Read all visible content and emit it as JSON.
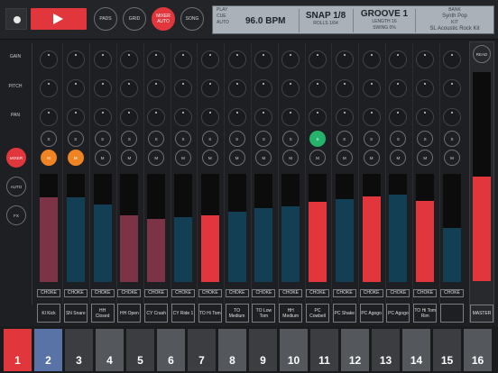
{
  "transport": {
    "record_label": "",
    "play_label": ""
  },
  "mode_buttons": [
    {
      "label": "PADS"
    },
    {
      "label": "GRID"
    },
    {
      "label": "MIXER AUTO"
    },
    {
      "label": "SONG"
    }
  ],
  "lcd": {
    "play_label": "PLAY",
    "cue_label": "CUE",
    "auto_label": "AUTO",
    "bpm": "96.0 BPM",
    "snap": "SNAP 1/8",
    "rolls": "ROLLS 1/64",
    "groove": "GROOVE 1",
    "length": "LENGTH 16",
    "swing": "SWING 0%",
    "bank_label": "BANK",
    "bank_value": "Synth Pop",
    "kit_label": "KIT",
    "kit_value": "SL Acoustic Rock Kit"
  },
  "left": {
    "gain": "GAIN",
    "pitch": "PITCH",
    "pan": "PAN",
    "mixer": "MIXER",
    "auto": "AUTO",
    "fx": "FX"
  },
  "channels": [
    {
      "name": "Kl Kick",
      "solo": "S",
      "mute": "M",
      "choke": "CHOKE",
      "level": 0.78,
      "color": "#7c3346",
      "solo_on": false,
      "mute_on": true
    },
    {
      "name": "SN Snare",
      "solo": "S",
      "mute": "M",
      "choke": "CHOKE",
      "level": 0.78,
      "color": "#133f55",
      "solo_on": false,
      "mute_on": true
    },
    {
      "name": "HH Closed",
      "solo": "S",
      "mute": "M",
      "choke": "CHOKE",
      "level": 0.72,
      "color": "#133f55",
      "solo_on": false,
      "mute_on": false
    },
    {
      "name": "HH Open",
      "solo": "S",
      "mute": "M",
      "choke": "CHOKE",
      "level": 0.62,
      "color": "#7c3346",
      "solo_on": false,
      "mute_on": false
    },
    {
      "name": "CY Crash",
      "solo": "S",
      "mute": "M",
      "choke": "CHOKE",
      "level": 0.58,
      "color": "#7c3346",
      "solo_on": false,
      "mute_on": false
    },
    {
      "name": "CY Ride 1",
      "solo": "S",
      "mute": "M",
      "choke": "CHOKE",
      "level": 0.6,
      "color": "#133f55",
      "solo_on": false,
      "mute_on": false
    },
    {
      "name": "TO Hi Tom",
      "solo": "S",
      "mute": "M",
      "choke": "CHOKE",
      "level": 0.62,
      "color": "#e2363d",
      "solo_on": false,
      "mute_on": false
    },
    {
      "name": "TO Medium",
      "solo": "S",
      "mute": "M",
      "choke": "CHOKE",
      "level": 0.65,
      "color": "#133f55",
      "solo_on": false,
      "mute_on": false
    },
    {
      "name": "TO Low Tom",
      "solo": "S",
      "mute": "M",
      "choke": "CHOKE",
      "level": 0.68,
      "color": "#133f55",
      "solo_on": false,
      "mute_on": false
    },
    {
      "name": "HH Medium",
      "solo": "S",
      "mute": "M",
      "choke": "CHOKE",
      "level": 0.7,
      "color": "#133f55",
      "solo_on": false,
      "mute_on": false
    },
    {
      "name": "PC Cowbell",
      "solo": "S",
      "mute": "M",
      "choke": "CHOKE",
      "level": 0.74,
      "color": "#e2363d",
      "solo_on": true,
      "mute_on": false
    },
    {
      "name": "PC Shake",
      "solo": "S",
      "mute": "M",
      "choke": "CHOKE",
      "level": 0.77,
      "color": "#133f55",
      "solo_on": false,
      "mute_on": false
    },
    {
      "name": "PC Agogo",
      "solo": "S",
      "mute": "M",
      "choke": "CHOKE",
      "level": 0.79,
      "color": "#e2363d",
      "solo_on": false,
      "mute_on": false
    },
    {
      "name": "PC Agogo",
      "solo": "S",
      "mute": "M",
      "choke": "CHOKE",
      "level": 0.81,
      "color": "#133f55",
      "solo_on": false,
      "mute_on": false
    },
    {
      "name": "TO Hi Tom Rim",
      "solo": "S",
      "mute": "M",
      "choke": "CHOKE",
      "level": 0.75,
      "color": "#e2363d",
      "solo_on": false,
      "mute_on": false
    },
    {
      "name": "",
      "solo": "S",
      "mute": "M",
      "choke": "CHOKE",
      "level": 0.5,
      "color": "#133f55",
      "solo_on": false,
      "mute_on": false
    }
  ],
  "master": {
    "read": "READ",
    "label": "MASTER",
    "level": 0.5
  },
  "pads": [
    "1",
    "2",
    "3",
    "4",
    "5",
    "6",
    "7",
    "8",
    "9",
    "10",
    "11",
    "12",
    "13",
    "14",
    "15",
    "16"
  ]
}
